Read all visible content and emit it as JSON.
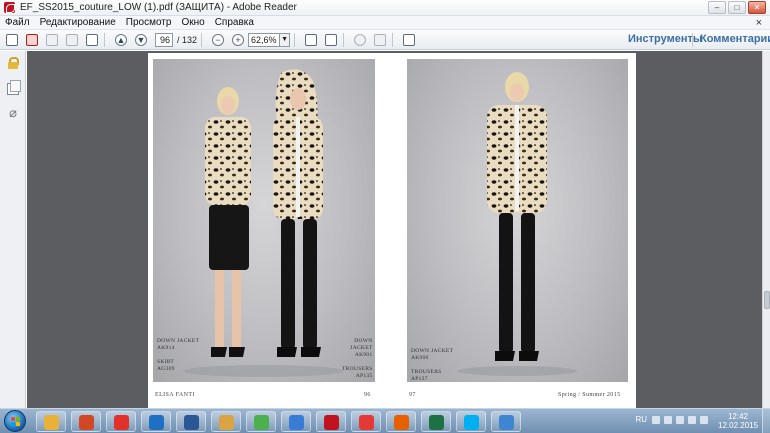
{
  "window": {
    "title": "EF_SS2015_couture_LOW (1).pdf (ЗАЩИТА) - Adobe Reader",
    "controls": {
      "minimize": "–",
      "maximize": "□",
      "close": "✕"
    }
  },
  "menubar": {
    "items": [
      "Файл",
      "Редактирование",
      "Просмотр",
      "Окно",
      "Справка"
    ],
    "close_doc": "×"
  },
  "toolbar": {
    "page_current": "96",
    "page_total": "/ 132",
    "zoom_value": "62,6%",
    "zoom_drop": "▼",
    "prev_arrow": "▲",
    "next_arrow": "▼",
    "zoom_out": "−",
    "zoom_in": "+",
    "tools_label": "Инструменты",
    "comments_label": "Комментарии"
  },
  "sidebar": {
    "attachment_glyph": "⌀"
  },
  "document": {
    "left_page": {
      "caption_left": "DOWN JACKET\nAK914\n\nSKIRT\nAG309",
      "caption_right": "DOWN\nJACKET\nAK901\n\nTROUSERS\nAP135",
      "footer_left": "ELISA FANTI",
      "footer_right": "96"
    },
    "right_page": {
      "caption_left": "DOWN JACKET\nAK900\n\nTROUSERS\nAP137",
      "footer_left": "97",
      "footer_right": "Spring / Summer 2015"
    }
  },
  "taskbar": {
    "language": "RU",
    "time": "12:42",
    "date": "12.02.2015",
    "apps": [
      {
        "name": "chrome",
        "color": "#e8b23a"
      },
      {
        "name": "powerpoint",
        "color": "#d24726"
      },
      {
        "name": "yandex",
        "color": "#e0312a"
      },
      {
        "name": "hp",
        "color": "#1f6fc5"
      },
      {
        "name": "word",
        "color": "#2b5797"
      },
      {
        "name": "folder",
        "color": "#d9a441"
      },
      {
        "name": "icq",
        "color": "#4caf50"
      },
      {
        "name": "mail-at",
        "color": "#3a7bd5"
      },
      {
        "name": "adobe-reader",
        "color": "#c1121f"
      },
      {
        "name": "yandex-browser",
        "color": "#e53935"
      },
      {
        "name": "firefox",
        "color": "#e66000"
      },
      {
        "name": "excel",
        "color": "#1e7145"
      },
      {
        "name": "skype",
        "color": "#00aff0"
      },
      {
        "name": "globe",
        "color": "#3f86d1"
      }
    ]
  },
  "colors": {
    "viewer_bg": "#5b5d60",
    "link_blue": "#3d6fa5",
    "taskbar": "#7f9cbd"
  }
}
